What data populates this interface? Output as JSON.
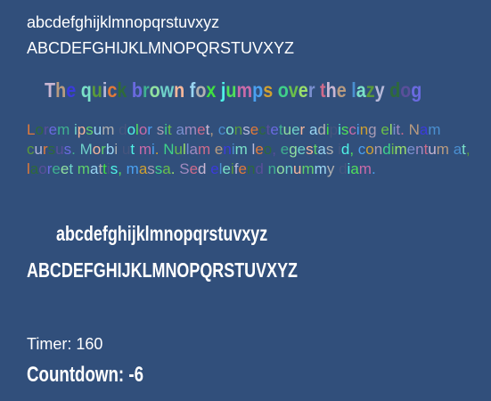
{
  "lower": "abcdefghijklmnopqrstuvxyz",
  "upper": "ABCDEFGHIJKLMNOPQRSTUVXYZ",
  "fox": "The quick brown fox jumps over the lazy dog",
  "lorem": "Lorem ipsum dolor sit amet, consectetuer adipiscing elit. Nam cursus. Morbi ut mi. Nullam enim leo, egestas id, condimentum at, laoreet mattis, massa. Sed eleifend nonummy diam.",
  "lower_bold": "abcdefghijklmnopqrstuvxyz",
  "upper_bold": "ABCDEFGHIJKLMNOPQRSTUVXYZ",
  "timer": "Timer: 160",
  "countdown": "Countdown: -6",
  "palette": [
    "#a89bb3",
    "#b7b9d9",
    "#46557e",
    "#c9b6d2",
    "#6fd1c9",
    "#3fd18a",
    "#e07a3a",
    "#4ff2e6",
    "#b89b80",
    "#f7b79a",
    "#6bbf4a",
    "#2e6a3a",
    "#4fe05a",
    "#3b3bdc",
    "#5fd16a",
    "#9be06a",
    "#5a4f9a",
    "#c96aa8",
    "#4a8fd0",
    "#9ad6f2",
    "#7a8fd0",
    "#6a6ae0",
    "#4aa0f0",
    "#7ae0c8",
    "#b0b0b0",
    "#a08ac0",
    "#3fb090",
    "#d0a030",
    "#5a9a3a",
    "#40e040",
    "#d06a8a",
    "#90e0a0"
  ]
}
